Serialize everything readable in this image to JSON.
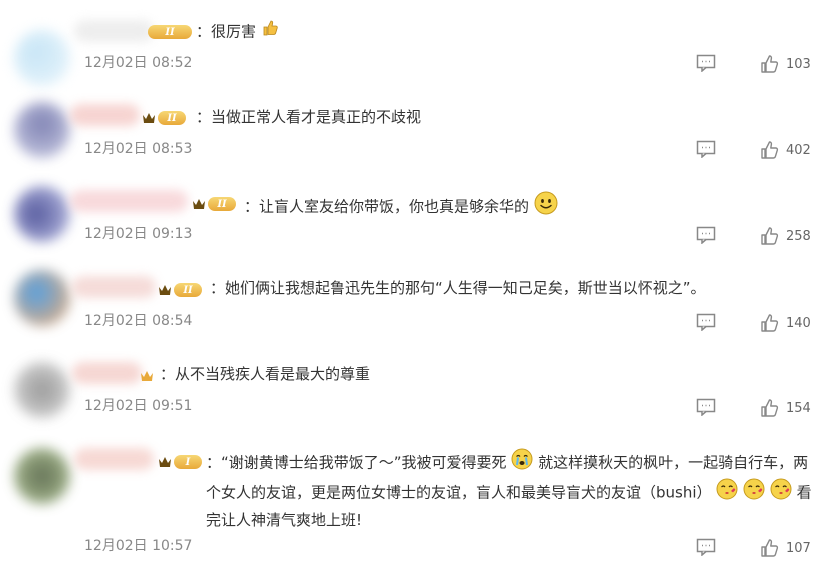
{
  "comments": [
    {
      "text": "：很厉害",
      "time": "12月02日 08:52",
      "likes": "103"
    },
    {
      "text": "：当做正常人看才是真正的不歧视",
      "time": "12月02日 08:53",
      "likes": "402"
    },
    {
      "text": "：让盲人室友给你带饭，你也真是够余华的",
      "time": "12月02日 09:13",
      "likes": "258"
    },
    {
      "text": "：她们俩让我想起鲁迅先生的那句“人生得一知己足矣，斯世当以怀视之”。",
      "time": "12月02日 08:54",
      "likes": "140"
    },
    {
      "text": "：从不当残疾人看是最大的尊重",
      "time": "12月02日 09:51",
      "likes": "154"
    },
    {
      "text_part1": "：“谢谢黄博士给我带饭了～”我被可爱得要死",
      "text_part2": "就这样摸秋天的枫叶，一起骑自行车，两个女人的友谊，更是两位女博士的友谊，盲人和最美导盲犬的友谊（bushi）",
      "text_part3": "看完让人神清气爽地上班!",
      "time": "12月02日 10:57",
      "likes": "107"
    }
  ],
  "badges": {
    "level2": "II",
    "level1": "I"
  },
  "colors": {
    "text": "#333333",
    "time": "#888888",
    "icon": "#888888",
    "badge": "#e8a93a"
  },
  "icons": [
    "thumbs-up-emoji",
    "smile-emoji",
    "crying-emoji",
    "kiss-emoji",
    "reply-icon",
    "like-icon",
    "crown-icon"
  ]
}
